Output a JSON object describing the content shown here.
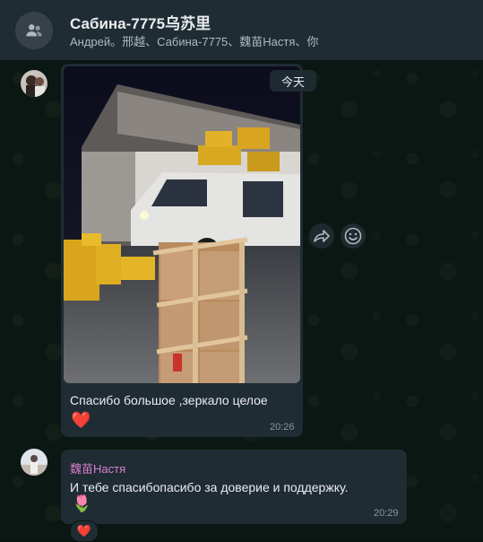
{
  "header": {
    "title": "Сабина-7775乌苏里",
    "members": "Андрей。邢越、Сабина-7775、魏苗Настя、你",
    "avatar_icon": "group-icon"
  },
  "date_chip": "今天",
  "messages": [
    {
      "type": "image",
      "caption": "Спасибо большое ,зеркало целое",
      "emoji": "❤️",
      "time": "20:26",
      "actions": {
        "forward_icon": "forward-icon",
        "react_icon": "emoji-icon"
      }
    },
    {
      "sender": "魏苗Настя",
      "text": "И тебе спасибопасибо за доверие и поддержку.",
      "emoji": "🌷",
      "time": "20:29",
      "reaction": "❤️"
    }
  ],
  "colors": {
    "header_bg": "#202c33",
    "bubble_bg": "#202c33",
    "chat_bg": "#0b1712",
    "sender_name": "#d77fd1",
    "time_text": "#8696a0"
  }
}
